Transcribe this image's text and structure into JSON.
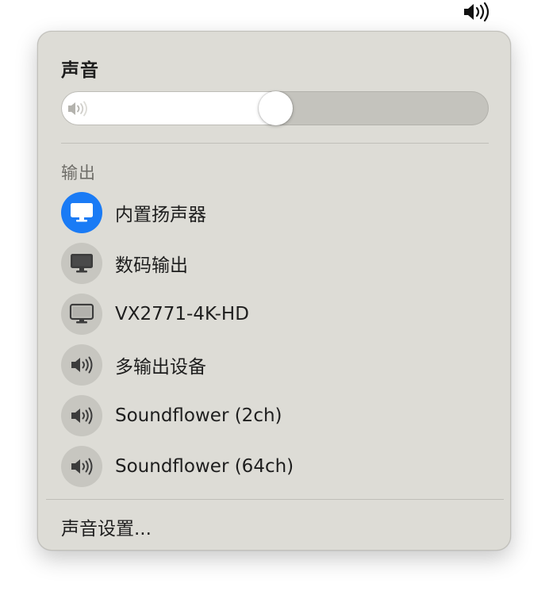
{
  "menubar": {
    "icon": "speaker-wave-icon"
  },
  "panel": {
    "title": "声音",
    "volume_percent": 50,
    "volume_icon": "speaker-low-icon",
    "output_section_label": "输出",
    "devices": [
      {
        "name": "内置扬声器",
        "icon": "monitor-icon",
        "selected": true
      },
      {
        "name": "数码输出",
        "icon": "monitor-icon",
        "selected": false
      },
      {
        "name": "VX2771-4K-HD",
        "icon": "monitor-icon",
        "selected": false
      },
      {
        "name": "多输出设备",
        "icon": "speaker-icon",
        "selected": false
      },
      {
        "name": "Soundflower (2ch)",
        "icon": "speaker-icon",
        "selected": false
      },
      {
        "name": "Soundflower (64ch)",
        "icon": "speaker-icon",
        "selected": false
      }
    ],
    "settings_link": "声音设置..."
  },
  "colors": {
    "panel_bg": "#dddcd6",
    "accent": "#1a7bf5",
    "icon_circle": "#c7c6c0",
    "icon_dark": "#3c3c3c"
  }
}
